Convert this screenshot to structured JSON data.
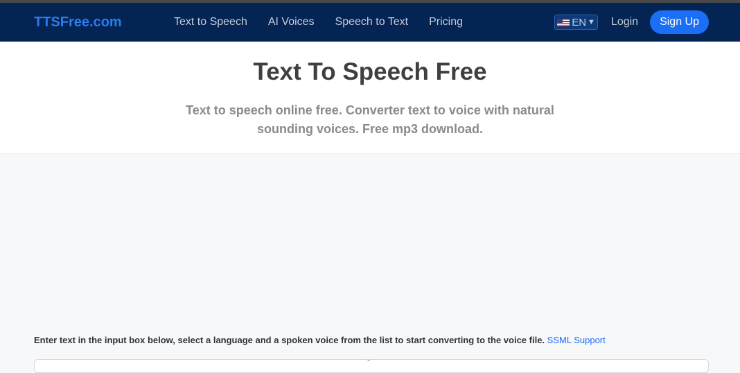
{
  "nav": {
    "brand": "TTSFree.com",
    "links": [
      "Text to Speech",
      "AI Voices",
      "Speech to Text",
      "Pricing"
    ],
    "language": "EN",
    "login": "Login",
    "signup": "Sign Up"
  },
  "hero": {
    "title": "Text To Speech Free",
    "subtitle": "Text to speech online free. Converter text to voice with natural sounding voices. Free mp3 download."
  },
  "instructions": {
    "text": "Enter text in the input box below, select a language and a spoken voice from the list to start converting to the voice file.",
    "link": "SSML Support"
  },
  "colors": {
    "navbar_bg": "#042454",
    "brand": "#2b7cf0",
    "accent": "#1a6ff5"
  },
  "icons": {
    "flag": "us-flag-icon",
    "dropdown": "chevron-down-icon"
  }
}
